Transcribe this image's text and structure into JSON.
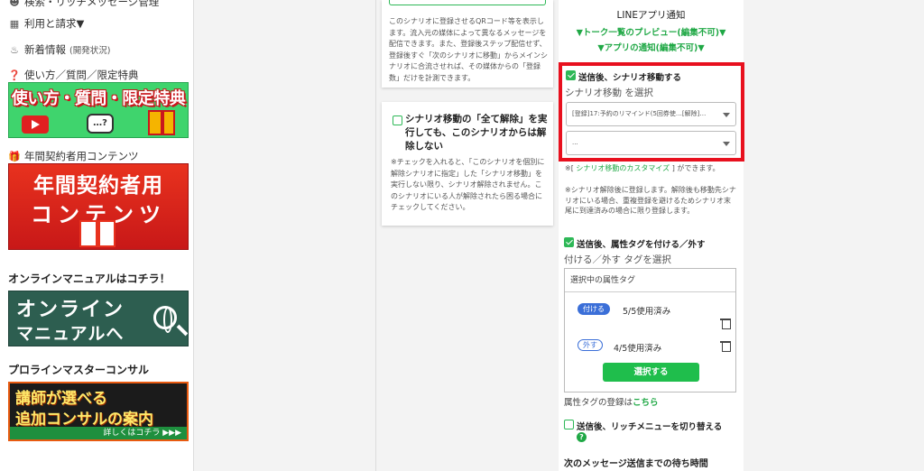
{
  "sidebar": {
    "top_cut": "検索・リッチメッセージ管理",
    "billing": "利用と請求▼",
    "news": "新着情報",
    "news_small": "(開発状況)",
    "howto": "使い方／質問／限定特典",
    "banner1_text": "使い方・質問・限定特典",
    "banner1_qa": "…?",
    "annual": "年間契約者用コンテンツ",
    "banner2_line1": "年間契約者用",
    "banner2_line2": "コンテンツ",
    "manual_head": "オンラインマニュアルはコチラ！",
    "banner3_line1": "オンライン",
    "banner3_line2": "マニュアルへ",
    "consult_head": "プロラインマスターコンサル",
    "banner4_line1": "講師が選べる",
    "banner4_line2": "追加コンサルの案内",
    "banner4_more": "詳しくはコチラ ▶▶▶"
  },
  "center": {
    "qr_desc": "このシナリオに登録させるQRコード等を表示します。流入元の媒体によって異なるメッセージを配信できます。また、登録後ステップ配信せず、登録後すぐ「次のシナリオに移動」からメインシナリオに合流させれば、その媒体からの「登録数」だけを計測できます。",
    "unlock_title": "シナリオ移動の「全て解除」を実行しても、このシナリオからは解除しない",
    "unlock_desc": "※チェックを入れると、「このシナリオを個別に解除シナリオに指定」した「シナリオ移動」を実行しない限り、シナリオ解除されません。このシナリオにいる人が解除されたら困る場合にチェックしてください。"
  },
  "right": {
    "line_notice": "LINEアプリ通知",
    "talk_preview": "▼トーク一覧のプレビュー(編集不可)▼",
    "app_notice": "▼アプリの通知(編集不可)▼",
    "move_check_label": "送信後、シナリオ移動する",
    "move_select_label": "シナリオ移動 を選択",
    "select1_value": "[登録]17:予約のリマインド(5回券使…[解除]…",
    "select2_value": "...",
    "customize_prefix": "※[",
    "customize_link": " シナリオ移動のカスタマイズ ",
    "customize_suffix": "] ができます。",
    "unlock_note": "※シナリオ解除後に登録します。解除後も移動先シナリオにいる場合、重複登録を避けるためシナリオ末尾に到達済みの場合に限り登録します。",
    "tag_check_label": "送信後、属性タグを付ける／外す",
    "tag_select_label": "付ける／外す タグを選択",
    "tag_panel_header": "選択中の属性タグ",
    "tag_add_pill": "付ける",
    "tag_add_usage": "5/5使用済み",
    "tag_remove_pill": "外す",
    "tag_remove_usage": "4/5使用済み",
    "select_button": "選択する",
    "tag_register_prefix": "属性タグの登録は",
    "tag_register_link": "こちら",
    "rich_menu_label": "送信後、リッチメニューを切り替える",
    "help_mark": "?",
    "wait_time_label": "次のメッセージ送信までの待ち時間"
  },
  "colors": {
    "accent_green": "#1fa845",
    "highlight_red": "#e8101e",
    "tag_blue": "#3b6fd8"
  }
}
